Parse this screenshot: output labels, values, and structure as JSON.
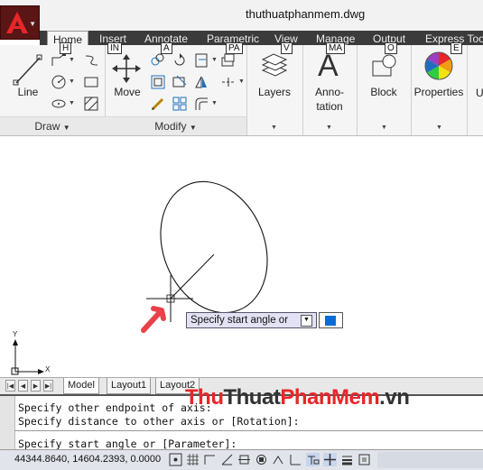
{
  "app": {
    "document_title": "thuthuatphanmem.dwg"
  },
  "ribbon_tabs": [
    {
      "label": "Home",
      "active": true,
      "keytip": "H"
    },
    {
      "label": "Insert",
      "keytip": "IN"
    },
    {
      "label": "Annotate",
      "keytip": "A"
    },
    {
      "label": "Parametric",
      "keytip": "PA"
    },
    {
      "label": "View",
      "keytip": "V"
    },
    {
      "label": "Manage",
      "keytip": "MA"
    },
    {
      "label": "Output",
      "keytip": "O"
    },
    {
      "label": "Express Tools",
      "keytip": "E"
    }
  ],
  "panels": {
    "draw": {
      "title": "Draw",
      "line_label": "Line"
    },
    "modify": {
      "title": "Modify",
      "move_label": "Move"
    },
    "layers": {
      "label": "Layers"
    },
    "annotation": {
      "label_line1": "Anno-",
      "label_line2": "tation",
      "glyph": "A"
    },
    "block": {
      "label": "Block"
    },
    "properties": {
      "label": "Properties"
    }
  },
  "canvas": {
    "tooltip": "Specify start angle or",
    "ucs": {
      "y": "Y",
      "x": "X"
    }
  },
  "layout_tabs": [
    {
      "label": "Model",
      "active": true
    },
    {
      "label": "Layout1"
    },
    {
      "label": "Layout2"
    }
  ],
  "command_history": [
    "Specify other endpoint of axis:",
    "Specify distance to other axis or [Rotation]:",
    "Specify start angle or [Parameter]:"
  ],
  "status": {
    "coordinates": "44344.8640, 14604.2393, 0.0000"
  },
  "watermark": {
    "part1": "Thu",
    "part2": "Thuat",
    "part3": "PhanMem",
    "part4": ".vn",
    "colors": [
      "#e8262a",
      "#333333",
      "#e8262a",
      "#333333"
    ]
  },
  "colors": {
    "app_button": "#5a1515",
    "tab_bar": "#3b3b3b",
    "tooltip_bg": "#e2e2f4",
    "input_fill": "#0a6cd8",
    "arrow_annotation": "#e8414a"
  }
}
